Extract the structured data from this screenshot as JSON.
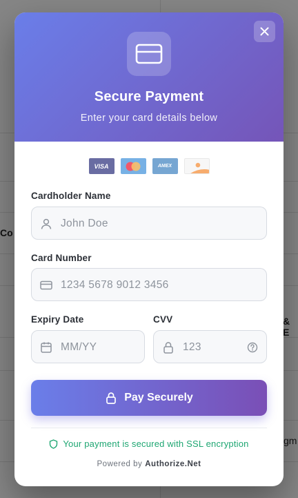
{
  "background": {
    "fragments": [
      "Co",
      "& E",
      "gm"
    ]
  },
  "modal": {
    "close_icon": "close-icon",
    "header_icon": "credit-card-icon",
    "title": "Secure Payment",
    "subtitle": "Enter your card details below",
    "accent_start": "#6a7ee9",
    "accent_end": "#7555b8",
    "card_logos": [
      "VISA",
      "mastercard",
      "AMEX",
      "discover"
    ]
  },
  "form": {
    "cardholder": {
      "label": "Cardholder Name",
      "placeholder": "John Doe",
      "icon": "user-icon"
    },
    "card_number": {
      "label": "Card Number",
      "placeholder": "1234 5678 9012 3456",
      "icon": "credit-card-icon"
    },
    "expiry": {
      "label": "Expiry Date",
      "placeholder": "MM/YY",
      "icon": "calendar-icon"
    },
    "cvv": {
      "label": "CVV",
      "placeholder": "123",
      "icon": "lock-icon",
      "help_icon": "help-circle-icon"
    }
  },
  "pay_button": {
    "label": "Pay Securely",
    "icon": "lock-icon"
  },
  "security": {
    "note": "Your payment is secured with SSL encryption",
    "color": "#1ea672",
    "powered_prefix": "Powered by",
    "powered_brand": "Authorize.Net"
  }
}
